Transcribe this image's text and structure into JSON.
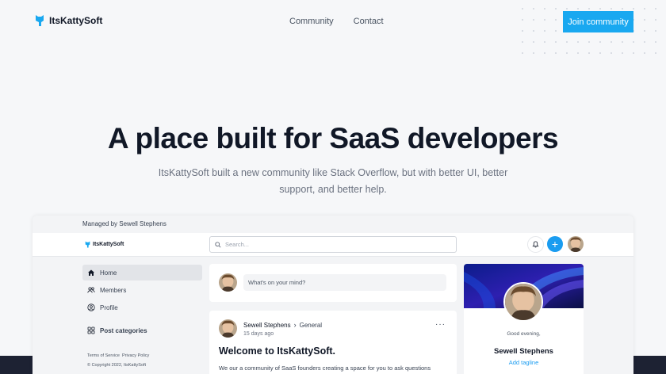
{
  "brand": {
    "name": "ItsKattySoft",
    "accent": "#19a8f0"
  },
  "nav": {
    "links": [
      "Community",
      "Contact"
    ],
    "cta_label": "Join community"
  },
  "hero": {
    "title": "A place built for SaaS developers",
    "subtitle": "ItsKattySoft built a new community like Stack Overflow, but with better UI, better support, and better help."
  },
  "app": {
    "managed_by": "Managed by Sewell Stephens",
    "brand_name": "ItsKattySoft",
    "search_placeholder": "Search...",
    "sidebar": {
      "items": [
        {
          "label": "Home",
          "icon": "home-icon",
          "active": true
        },
        {
          "label": "Members",
          "icon": "members-icon",
          "active": false
        },
        {
          "label": "Profile",
          "icon": "profile-icon",
          "active": false
        }
      ],
      "categories_label": "Post categories",
      "footer_links": [
        "Terms of Service",
        "Privacy Policy"
      ],
      "copyright": "© Copyright 2022, ItsKattySoft"
    },
    "compose_placeholder": "What's on your mind?",
    "post": {
      "author": "Sewell Stephens",
      "category": "General",
      "time": "15 days ago",
      "menu": "···",
      "title": "Welcome to ItsKattySoft.",
      "body": "We our a community of SaaS founders creating a space for you to ask questions"
    },
    "profile": {
      "greeting": "Good evening,",
      "name": "Sewell Stephens",
      "tagline_link": "Add tagline"
    }
  }
}
